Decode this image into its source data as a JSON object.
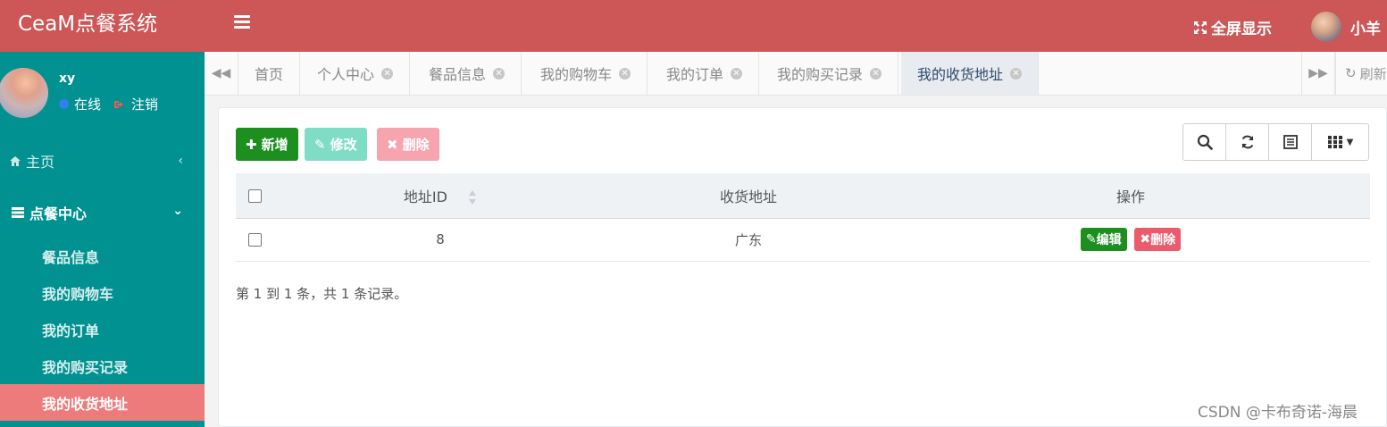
{
  "topbar": {
    "brand": "CeaM点餐系统",
    "fullscreen_label": "全屏显示",
    "username": "小羊"
  },
  "sidebar": {
    "profile": {
      "name": "xy",
      "status": "在线",
      "logout": "注销"
    },
    "home_label": "主页",
    "center_label": "点餐中心",
    "items": [
      {
        "label": "餐品信息"
      },
      {
        "label": "我的购物车"
      },
      {
        "label": "我的订单"
      },
      {
        "label": "我的购买记录"
      },
      {
        "label": "我的收货地址",
        "active": true
      }
    ]
  },
  "tabs": {
    "items": [
      {
        "label": "首页"
      },
      {
        "label": "个人中心"
      },
      {
        "label": "餐品信息"
      },
      {
        "label": "我的购物车"
      },
      {
        "label": "我的订单"
      },
      {
        "label": "我的购买记录"
      },
      {
        "label": "我的收货地址",
        "active": true
      }
    ],
    "refresh_label": "刷新"
  },
  "toolbar": {
    "add_label": "新增",
    "edit_label": "修改",
    "delete_label": "删除"
  },
  "table": {
    "headers": [
      "地址ID",
      "收货地址",
      "操作"
    ],
    "rows": [
      {
        "id": "8",
        "address": "广东",
        "edit_label": "编辑",
        "delete_label": "删除"
      }
    ]
  },
  "pager_text": "第 1 到 1 条，共 1 条记录。",
  "watermark": "CSDN @卡布奇诺-海晨",
  "colors": {
    "topbar": "#cd5656",
    "sidebar": "#019191",
    "active_nav": "#ee7b7b",
    "add_button": "#1c8f1f",
    "edit_button": "#7fdcc5",
    "delete_button": "#f6a4ad"
  }
}
